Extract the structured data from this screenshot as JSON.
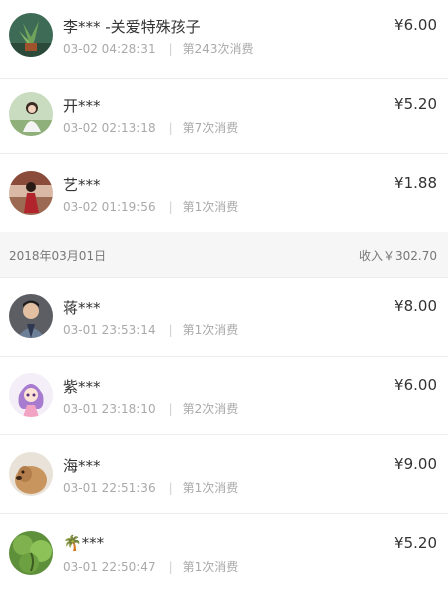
{
  "transactions_top": [
    {
      "name": "李*** -关爱特殊孩子",
      "time": "03-02 04:28:31",
      "count": "第243次消费",
      "amount": "¥6.00"
    },
    {
      "name": "开***",
      "time": "03-02 02:13:18",
      "count": "第7次消费",
      "amount": "¥5.20"
    },
    {
      "name": "艺***",
      "time": "03-02 01:19:56",
      "count": "第1次消费",
      "amount": "¥1.88"
    }
  ],
  "date_group": {
    "date": "2018年03月01日",
    "income": "收入￥302.70"
  },
  "transactions_bottom": [
    {
      "name": "蒋***",
      "time": "03-01 23:53:14",
      "count": "第1次消费",
      "amount": "¥8.00"
    },
    {
      "name": "紫***",
      "time": "03-01 23:18:10",
      "count": "第2次消费",
      "amount": "¥6.00"
    },
    {
      "name": "海***",
      "time": "03-01 22:51:36",
      "count": "第1次消费",
      "amount": "¥9.00"
    },
    {
      "name": "🌴***",
      "time": "03-01 22:50:47",
      "count": "第1次消费",
      "amount": "¥5.20"
    }
  ],
  "separator": "|"
}
